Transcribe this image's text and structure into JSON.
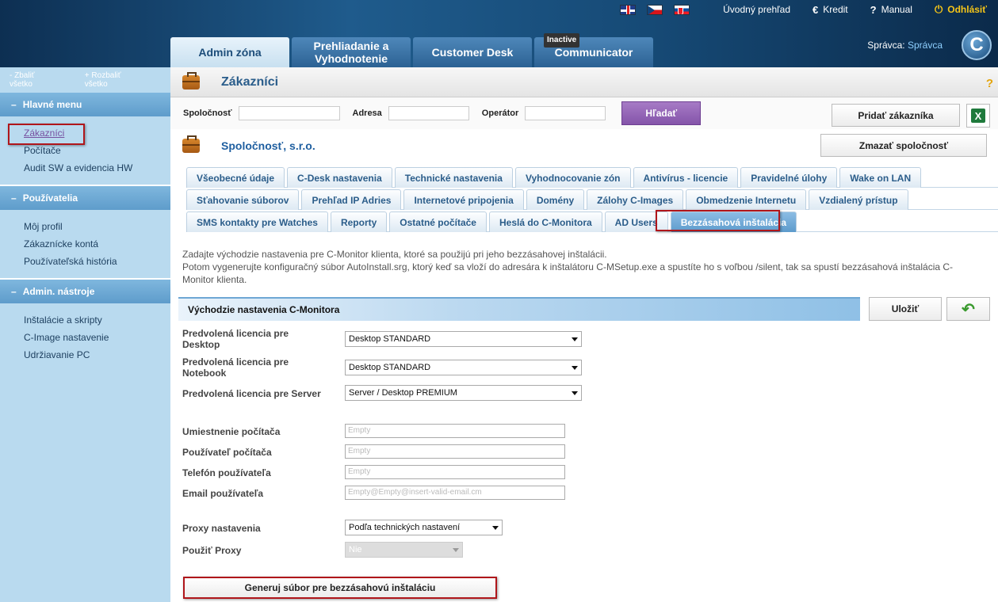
{
  "header": {
    "flags": [
      "uk-flag",
      "cz-flag",
      "sk-flag"
    ],
    "links": {
      "overview": "Úvodný prehľad",
      "credit": "Kredit",
      "manual": "Manual",
      "logout": "Odhlásiť"
    },
    "tabs": [
      {
        "label": "Admin zóna",
        "badge": ""
      },
      {
        "label": "Prehliadanie a Vyhodnotenie",
        "badge": ""
      },
      {
        "label": "Customer Desk",
        "badge": ""
      },
      {
        "label": "Communicator",
        "badge": "Inactive"
      }
    ],
    "admin_label": "Správca:",
    "admin_name": "Správca",
    "logo_letter": "C"
  },
  "sidebar": {
    "collapse_all": "Zbaliť všetko",
    "expand_all": "Rozbaliť všetko",
    "sections": [
      {
        "title": "Hlavné menu",
        "items": [
          "Zákazníci",
          "Počítače",
          "Audit SW a evidencia HW"
        ]
      },
      {
        "title": "Používatelia",
        "items": [
          "Môj profil",
          "Zákaznícke kontá",
          "Používateľská história"
        ]
      },
      {
        "title": "Admin. nástroje",
        "items": [
          "Inštalácie a skripty",
          "C-Image nastavenie",
          "Udržiavanie PC"
        ]
      }
    ]
  },
  "page": {
    "title": "Zákazníci",
    "help": "?",
    "search": {
      "company_label": "Spoločnosť",
      "address_label": "Adresa",
      "operator_label": "Operátor",
      "search_button": "Hľadať",
      "add_customer_button": "Pridať zákazníka",
      "excel_icon": "X"
    },
    "company_name": "Spoločnosť, s.r.o.",
    "delete_company_button": "Zmazať spoločnosť",
    "subtabs": [
      [
        "Všeobecné údaje",
        "C-Desk nastavenia",
        "Technické nastavenia",
        "Vyhodnocovanie zón",
        "Antivírus - licencie",
        "Pravidelné úlohy",
        "Wake on LAN"
      ],
      [
        "Sťahovanie súborov",
        "Prehľad IP Adries",
        "Internetové pripojenia",
        "Domény",
        "Zálohy C-Images",
        "Obmedzenie Internetu",
        "Vzdialený prístup"
      ],
      [
        "SMS kontakty pre Watches",
        "Reporty",
        "Ostatné počítače",
        "Heslá do C-Monitora",
        "AD Users",
        "Bezzásahová inštalácia"
      ]
    ],
    "description": [
      "Zadajte východzie nastavenia pre C-Monitor klienta, ktoré sa použijú pri jeho bezzásahovej inštalácii.",
      "Potom vygenerujte konfiguračný súbor AutoInstall.srg, ktorý keď sa vloží do adresára k inštalátoru C-MSetup.exe a spustíte ho s voľbou /silent, tak sa spustí bezzásahová inštalácia C-Monitor klienta."
    ],
    "section_title": "Východzie nastavenia C-Monitora",
    "save_button": "Uložiť",
    "form": {
      "desktop_license_label": "Predvolená licencia pre Desktop",
      "desktop_license_value": "Desktop STANDARD",
      "notebook_license_label": "Predvolená licencia pre Notebook",
      "notebook_license_value": "Desktop STANDARD",
      "server_license_label": "Predvolená licencia pre Server",
      "server_license_value": "Server / Desktop PREMIUM",
      "location_label": "Umiestnenie počítača",
      "location_placeholder": "Empty",
      "user_label": "Používateľ počítača",
      "user_placeholder": "Empty",
      "phone_label": "Telefón používateľa",
      "phone_placeholder": "Empty",
      "email_label": "Email používateľa",
      "email_placeholder": "Empty@Empty@insert-valid-email.cm",
      "proxy_label": "Proxy nastavenia",
      "proxy_value": "Podľa technických nastavení",
      "use_proxy_label": "Použiť Proxy",
      "use_proxy_value": "Nie"
    },
    "generate_button": "Generuj súbor pre bezzásahovú inštaláciu"
  }
}
